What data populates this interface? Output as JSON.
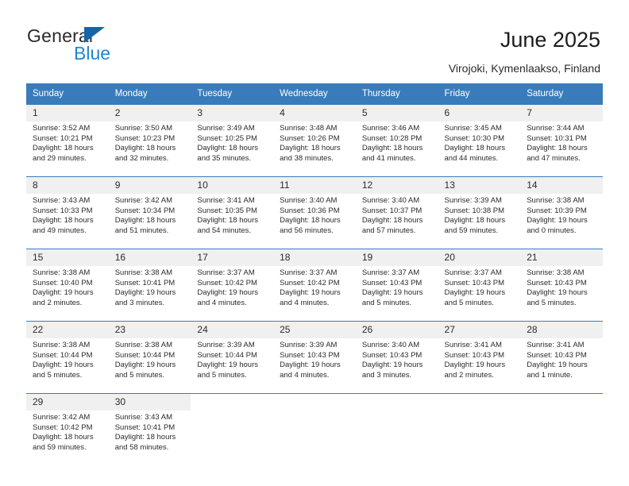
{
  "brand": {
    "name_top": "General",
    "name_bottom": "Blue",
    "accent_color": "#1e87d6",
    "triangle_color": "#1565a8"
  },
  "header": {
    "title": "June 2025",
    "subtitle": "Virojoki, Kymenlaakso, Finland"
  },
  "calendar": {
    "header_bg": "#3a7cbb",
    "daynum_bg": "#f0f0f0",
    "weekday_headers": [
      "Sunday",
      "Monday",
      "Tuesday",
      "Wednesday",
      "Thursday",
      "Friday",
      "Saturday"
    ],
    "weeks": [
      [
        {
          "day": "1",
          "sunrise": "Sunrise: 3:52 AM",
          "sunset": "Sunset: 10:21 PM",
          "daylight_1": "Daylight: 18 hours",
          "daylight_2": "and 29 minutes."
        },
        {
          "day": "2",
          "sunrise": "Sunrise: 3:50 AM",
          "sunset": "Sunset: 10:23 PM",
          "daylight_1": "Daylight: 18 hours",
          "daylight_2": "and 32 minutes."
        },
        {
          "day": "3",
          "sunrise": "Sunrise: 3:49 AM",
          "sunset": "Sunset: 10:25 PM",
          "daylight_1": "Daylight: 18 hours",
          "daylight_2": "and 35 minutes."
        },
        {
          "day": "4",
          "sunrise": "Sunrise: 3:48 AM",
          "sunset": "Sunset: 10:26 PM",
          "daylight_1": "Daylight: 18 hours",
          "daylight_2": "and 38 minutes."
        },
        {
          "day": "5",
          "sunrise": "Sunrise: 3:46 AM",
          "sunset": "Sunset: 10:28 PM",
          "daylight_1": "Daylight: 18 hours",
          "daylight_2": "and 41 minutes."
        },
        {
          "day": "6",
          "sunrise": "Sunrise: 3:45 AM",
          "sunset": "Sunset: 10:30 PM",
          "daylight_1": "Daylight: 18 hours",
          "daylight_2": "and 44 minutes."
        },
        {
          "day": "7",
          "sunrise": "Sunrise: 3:44 AM",
          "sunset": "Sunset: 10:31 PM",
          "daylight_1": "Daylight: 18 hours",
          "daylight_2": "and 47 minutes."
        }
      ],
      [
        {
          "day": "8",
          "sunrise": "Sunrise: 3:43 AM",
          "sunset": "Sunset: 10:33 PM",
          "daylight_1": "Daylight: 18 hours",
          "daylight_2": "and 49 minutes."
        },
        {
          "day": "9",
          "sunrise": "Sunrise: 3:42 AM",
          "sunset": "Sunset: 10:34 PM",
          "daylight_1": "Daylight: 18 hours",
          "daylight_2": "and 51 minutes."
        },
        {
          "day": "10",
          "sunrise": "Sunrise: 3:41 AM",
          "sunset": "Sunset: 10:35 PM",
          "daylight_1": "Daylight: 18 hours",
          "daylight_2": "and 54 minutes."
        },
        {
          "day": "11",
          "sunrise": "Sunrise: 3:40 AM",
          "sunset": "Sunset: 10:36 PM",
          "daylight_1": "Daylight: 18 hours",
          "daylight_2": "and 56 minutes."
        },
        {
          "day": "12",
          "sunrise": "Sunrise: 3:40 AM",
          "sunset": "Sunset: 10:37 PM",
          "daylight_1": "Daylight: 18 hours",
          "daylight_2": "and 57 minutes."
        },
        {
          "day": "13",
          "sunrise": "Sunrise: 3:39 AM",
          "sunset": "Sunset: 10:38 PM",
          "daylight_1": "Daylight: 18 hours",
          "daylight_2": "and 59 minutes."
        },
        {
          "day": "14",
          "sunrise": "Sunrise: 3:38 AM",
          "sunset": "Sunset: 10:39 PM",
          "daylight_1": "Daylight: 19 hours",
          "daylight_2": "and 0 minutes."
        }
      ],
      [
        {
          "day": "15",
          "sunrise": "Sunrise: 3:38 AM",
          "sunset": "Sunset: 10:40 PM",
          "daylight_1": "Daylight: 19 hours",
          "daylight_2": "and 2 minutes."
        },
        {
          "day": "16",
          "sunrise": "Sunrise: 3:38 AM",
          "sunset": "Sunset: 10:41 PM",
          "daylight_1": "Daylight: 19 hours",
          "daylight_2": "and 3 minutes."
        },
        {
          "day": "17",
          "sunrise": "Sunrise: 3:37 AM",
          "sunset": "Sunset: 10:42 PM",
          "daylight_1": "Daylight: 19 hours",
          "daylight_2": "and 4 minutes."
        },
        {
          "day": "18",
          "sunrise": "Sunrise: 3:37 AM",
          "sunset": "Sunset: 10:42 PM",
          "daylight_1": "Daylight: 19 hours",
          "daylight_2": "and 4 minutes."
        },
        {
          "day": "19",
          "sunrise": "Sunrise: 3:37 AM",
          "sunset": "Sunset: 10:43 PM",
          "daylight_1": "Daylight: 19 hours",
          "daylight_2": "and 5 minutes."
        },
        {
          "day": "20",
          "sunrise": "Sunrise: 3:37 AM",
          "sunset": "Sunset: 10:43 PM",
          "daylight_1": "Daylight: 19 hours",
          "daylight_2": "and 5 minutes."
        },
        {
          "day": "21",
          "sunrise": "Sunrise: 3:38 AM",
          "sunset": "Sunset: 10:43 PM",
          "daylight_1": "Daylight: 19 hours",
          "daylight_2": "and 5 minutes."
        }
      ],
      [
        {
          "day": "22",
          "sunrise": "Sunrise: 3:38 AM",
          "sunset": "Sunset: 10:44 PM",
          "daylight_1": "Daylight: 19 hours",
          "daylight_2": "and 5 minutes."
        },
        {
          "day": "23",
          "sunrise": "Sunrise: 3:38 AM",
          "sunset": "Sunset: 10:44 PM",
          "daylight_1": "Daylight: 19 hours",
          "daylight_2": "and 5 minutes."
        },
        {
          "day": "24",
          "sunrise": "Sunrise: 3:39 AM",
          "sunset": "Sunset: 10:44 PM",
          "daylight_1": "Daylight: 19 hours",
          "daylight_2": "and 5 minutes."
        },
        {
          "day": "25",
          "sunrise": "Sunrise: 3:39 AM",
          "sunset": "Sunset: 10:43 PM",
          "daylight_1": "Daylight: 19 hours",
          "daylight_2": "and 4 minutes."
        },
        {
          "day": "26",
          "sunrise": "Sunrise: 3:40 AM",
          "sunset": "Sunset: 10:43 PM",
          "daylight_1": "Daylight: 19 hours",
          "daylight_2": "and 3 minutes."
        },
        {
          "day": "27",
          "sunrise": "Sunrise: 3:41 AM",
          "sunset": "Sunset: 10:43 PM",
          "daylight_1": "Daylight: 19 hours",
          "daylight_2": "and 2 minutes."
        },
        {
          "day": "28",
          "sunrise": "Sunrise: 3:41 AM",
          "sunset": "Sunset: 10:43 PM",
          "daylight_1": "Daylight: 19 hours",
          "daylight_2": "and 1 minute."
        }
      ],
      [
        {
          "day": "29",
          "sunrise": "Sunrise: 3:42 AM",
          "sunset": "Sunset: 10:42 PM",
          "daylight_1": "Daylight: 18 hours",
          "daylight_2": "and 59 minutes."
        },
        {
          "day": "30",
          "sunrise": "Sunrise: 3:43 AM",
          "sunset": "Sunset: 10:41 PM",
          "daylight_1": "Daylight: 18 hours",
          "daylight_2": "and 58 minutes."
        },
        {
          "day": "",
          "sunrise": "",
          "sunset": "",
          "daylight_1": "",
          "daylight_2": ""
        },
        {
          "day": "",
          "sunrise": "",
          "sunset": "",
          "daylight_1": "",
          "daylight_2": ""
        },
        {
          "day": "",
          "sunrise": "",
          "sunset": "",
          "daylight_1": "",
          "daylight_2": ""
        },
        {
          "day": "",
          "sunrise": "",
          "sunset": "",
          "daylight_1": "",
          "daylight_2": ""
        },
        {
          "day": "",
          "sunrise": "",
          "sunset": "",
          "daylight_1": "",
          "daylight_2": ""
        }
      ]
    ]
  }
}
